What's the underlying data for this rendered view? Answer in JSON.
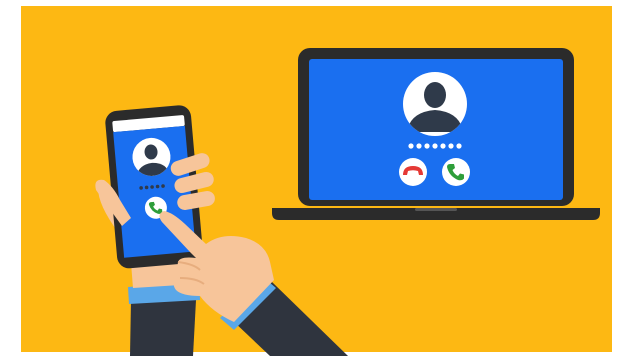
{
  "scene": {
    "background_color": "#FDB813",
    "screen_color": "#1A6FF0",
    "device_frame_color": "#2B2B2B",
    "sleeve_color": "#2F343E",
    "cuff_color": "#5AA7E8",
    "skin_color": "#F7C59A",
    "decline_color": "#E53935",
    "accept_color": "#2E9E3A"
  },
  "phone": {
    "contact_icon": "avatar-silhouette-icon",
    "accept_icon": "phone-accept-icon"
  },
  "laptop": {
    "contact_icon": "avatar-silhouette-icon",
    "decline_icon": "phone-decline-icon",
    "accept_icon": "phone-accept-icon"
  }
}
